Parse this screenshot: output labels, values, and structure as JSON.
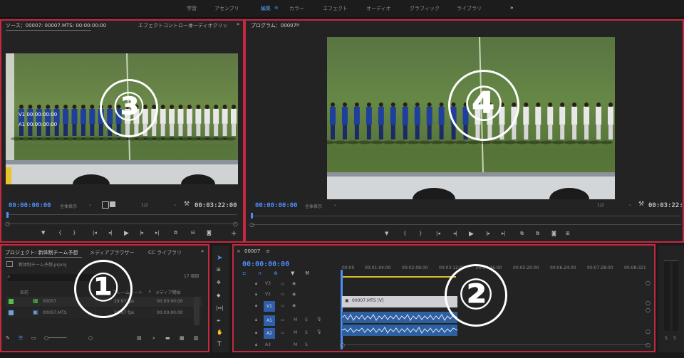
{
  "workspace_tabs": [
    "学習",
    "アセンブリ",
    "編集",
    "カラー",
    "エフェクト",
    "オーディオ",
    "グラフィック",
    "ライブラリ"
  ],
  "workspace_active": "編集",
  "workspace_more": "»",
  "source": {
    "tab_label": "ソース：00007: 00007.MTS: 00:00:00:00",
    "tab_effects": "エフェクトコントロール",
    "tab_audio": "オーディオクリッ",
    "overlay_v1": "V1 00:00:00:00",
    "overlay_a1": "A1 00:00:00:00",
    "timecode_in": "00:00:00:00",
    "zoom_select": "全体表示",
    "resolution": "1/2",
    "timecode_dur": "00:03:22:00",
    "badge": "③"
  },
  "program": {
    "tab_label": "プログラム：00007",
    "timecode_in": "00:00:00:00",
    "zoom_select": "全体表示",
    "resolution": "1/2",
    "timecode_dur": "00:03:22:00",
    "badge": "④"
  },
  "project": {
    "tab_label": "プロジェクト: 新体制チーム予想",
    "tab_media": "メディアブラウザー",
    "tab_cc": "CC ライブラリ",
    "file": "新体制チーム予想.prproj",
    "count": "17 項目",
    "col_name": "名前",
    "col_rate": "フレームレート",
    "col_start": "メディア開始",
    "rows": [
      {
        "name": "00007",
        "rate": "29.97 fps",
        "start": "00:00:00:00"
      },
      {
        "name": "00007.MTS",
        "rate": "29.97 fps",
        "start": "00:00:00:00"
      }
    ],
    "badge": "①"
  },
  "timeline": {
    "tab_label": "00007",
    "timecode": "00:00:00:00",
    "ruler": [
      "00:00",
      "00:01:04:00",
      "00:02:08:00",
      "00:03:12:00",
      "00:04:16:00",
      "00:05:20:00",
      "00:06:24:00",
      "00:07:28:00",
      "00:08:321"
    ],
    "tracks": [
      "V3",
      "V2",
      "V1",
      "A1",
      "A2",
      "A3"
    ],
    "clip_label": "00007.MTS [V]",
    "badge": "②"
  },
  "colors": {
    "accent": "#4d8df7",
    "highlight_red": "#c6283f"
  }
}
